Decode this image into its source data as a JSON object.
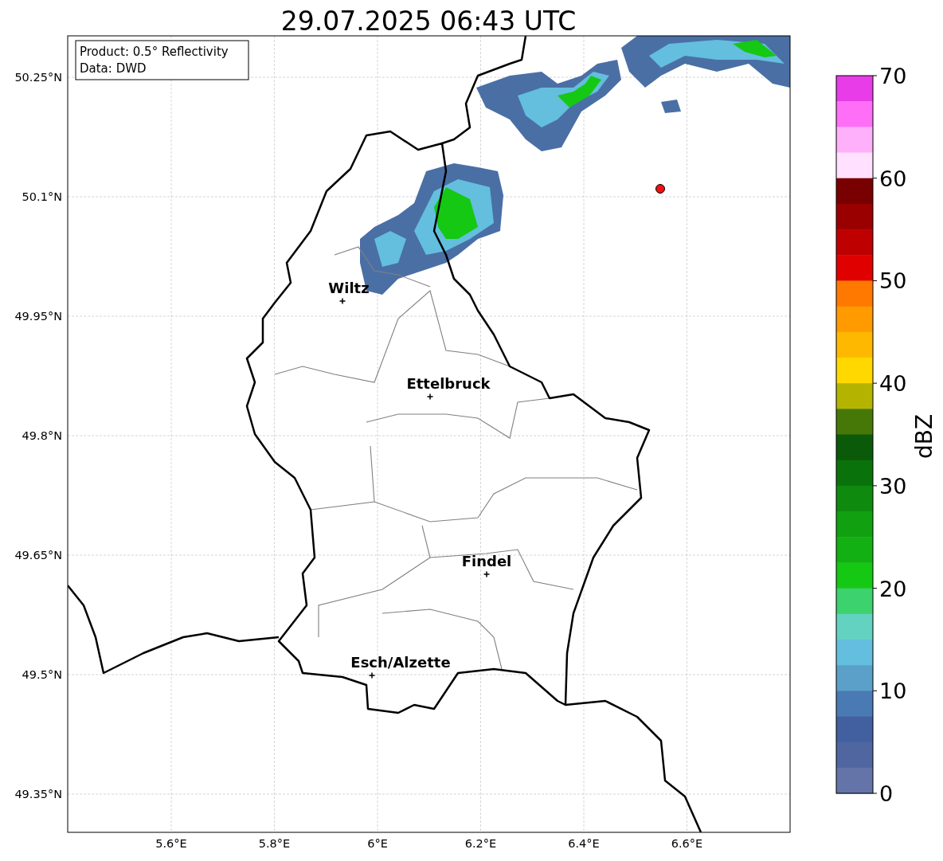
{
  "title": "29.07.2025 06:43 UTC",
  "info_box": [
    "Product: 0.5° Reflectivity",
    "Data: DWD"
  ],
  "y_ticks": [
    "50.25°N",
    "50.1°N",
    "49.95°N",
    "49.8°N",
    "49.65°N",
    "49.5°N",
    "49.35°N"
  ],
  "x_ticks": [
    "5.6°E",
    "5.8°E",
    "6°E",
    "6.2°E",
    "6.4°E",
    "6.6°E"
  ],
  "cities": [
    {
      "name": "Wiltz"
    },
    {
      "name": "Ettelbruck"
    },
    {
      "name": "Findel"
    },
    {
      "name": "Esch/Alzette"
    }
  ],
  "colorbar": {
    "label": "dBZ",
    "ticks": [
      "70",
      "60",
      "50",
      "40",
      "30",
      "20",
      "10",
      "0"
    ],
    "segments": [
      {
        "color": "#e83ce8"
      },
      {
        "color": "#ff6ef6"
      },
      {
        "color": "#ffb0fa"
      },
      {
        "color": "#ffe0ff"
      },
      {
        "color": "#780000"
      },
      {
        "color": "#9a0000"
      },
      {
        "color": "#be0000"
      },
      {
        "color": "#e00000"
      },
      {
        "color": "#ff7800"
      },
      {
        "color": "#ff9a00"
      },
      {
        "color": "#ffb800"
      },
      {
        "color": "#ffd800"
      },
      {
        "color": "#b4b400"
      },
      {
        "color": "#467808"
      },
      {
        "color": "#0a5a0a"
      },
      {
        "color": "#0a720a"
      },
      {
        "color": "#0e8a0e"
      },
      {
        "color": "#10a010"
      },
      {
        "color": "#12b012"
      },
      {
        "color": "#14c814"
      },
      {
        "color": "#3cd26e"
      },
      {
        "color": "#64d2c0"
      },
      {
        "color": "#64bede"
      },
      {
        "color": "#5aa0c8"
      },
      {
        "color": "#4a7ab4"
      },
      {
        "color": "#4260a0"
      },
      {
        "color": "#5066a0"
      },
      {
        "color": "#6474a8"
      }
    ]
  }
}
